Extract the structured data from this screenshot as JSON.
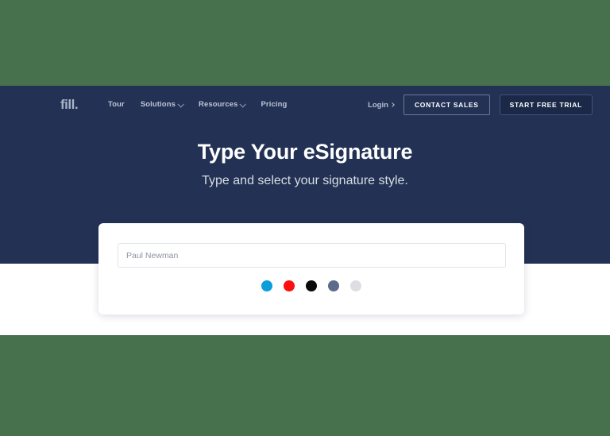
{
  "page": {
    "outer_background": "#47714d",
    "hero_background": "#233254",
    "content_background": "#ffffff"
  },
  "navbar": {
    "logo": "fill.",
    "links": [
      {
        "label": "Tour",
        "has_caret": false
      },
      {
        "label": "Solutions",
        "has_caret": true
      },
      {
        "label": "Resources",
        "has_caret": true
      },
      {
        "label": "Pricing",
        "has_caret": false
      }
    ],
    "login_label": "Login",
    "contact_sales_label": "CONTACT SALES",
    "start_trial_label": "START FREE TRIAL"
  },
  "hero": {
    "headline": "Type Your eSignature",
    "subheadline": "Type and select your signature style."
  },
  "signature_card": {
    "name_input": {
      "value": "",
      "placeholder": "Paul Newman"
    },
    "colors": [
      {
        "name": "blue",
        "hex": "#0c9ddb",
        "selected": false
      },
      {
        "name": "red",
        "hex": "#fb0f0f",
        "selected": false
      },
      {
        "name": "black",
        "hex": "#0a0a0a",
        "selected": false
      },
      {
        "name": "slate",
        "hex": "#5a6b8c",
        "selected": false
      },
      {
        "name": "light-gray",
        "hex": "#dcdee1",
        "selected": false
      }
    ]
  }
}
